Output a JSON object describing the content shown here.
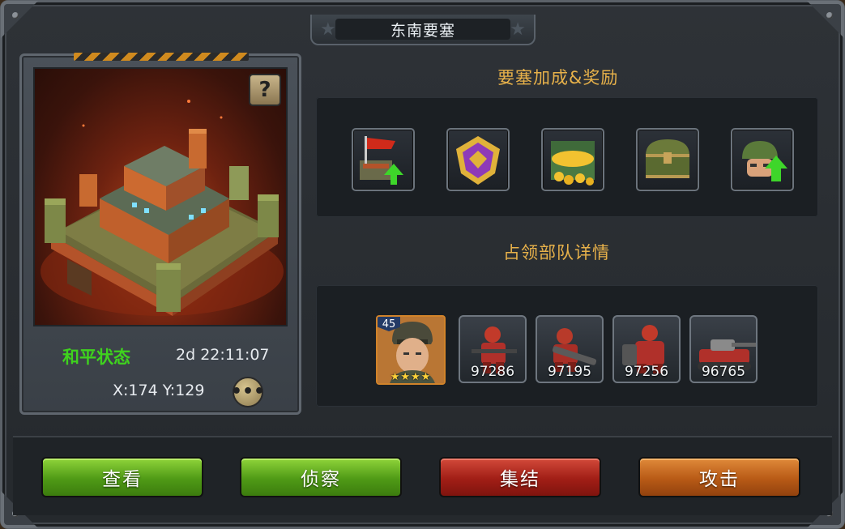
{
  "window": {
    "title": "东南要塞"
  },
  "fortress": {
    "help_label": "?",
    "status": "和平状态",
    "timer": "2d  22:11:07",
    "coords": "X:174 Y:129"
  },
  "rewards": {
    "title": "要塞加成&奖励",
    "items": [
      {
        "icon": "fortress-flag-upgrade-icon"
      },
      {
        "icon": "purple-rank-badge-icon"
      },
      {
        "icon": "gold-coins-chest-icon"
      },
      {
        "icon": "treasure-chest-icon"
      },
      {
        "icon": "soldier-helmet-upgrade-icon"
      }
    ]
  },
  "troops": {
    "title": "占领部队详情",
    "hero": {
      "level": "45",
      "stars": "★★★★"
    },
    "units": [
      {
        "icon": "rifleman-icon",
        "count": "97286"
      },
      {
        "icon": "rocket-soldier-icon",
        "count": "97195"
      },
      {
        "icon": "heavy-trooper-icon",
        "count": "97256"
      },
      {
        "icon": "tank-icon",
        "count": "96765"
      }
    ]
  },
  "actions": {
    "view": "查看",
    "scout": "侦察",
    "rally": "集结",
    "attack": "攻击"
  },
  "colors": {
    "status_green": "#3fd21e",
    "section_gold": "#e7b14a",
    "btn_green": "#4f9a16",
    "btn_red": "#a11e16",
    "btn_orange": "#b85a16"
  }
}
